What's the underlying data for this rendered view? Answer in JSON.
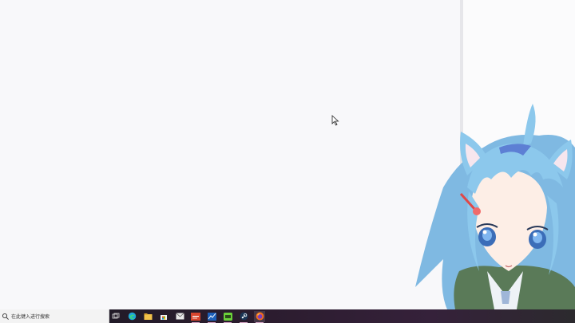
{
  "taskbar": {
    "search_placeholder": "在此键入进行搜索",
    "pinned_icons": [
      "task-view-icon",
      "edge-browser-icon",
      "file-explorer-icon",
      "store-icon",
      "mail-icon",
      "news-app-icon",
      "chart-app-icon",
      "green-app-icon",
      "steam-icon",
      "firefox-icon"
    ]
  },
  "colors": {
    "taskbar_dark": "#1c1a24",
    "taskbar_accent": "#35213a",
    "avatar_hair": "#8cc8ec",
    "avatar_jacket": "#5a7a58"
  }
}
